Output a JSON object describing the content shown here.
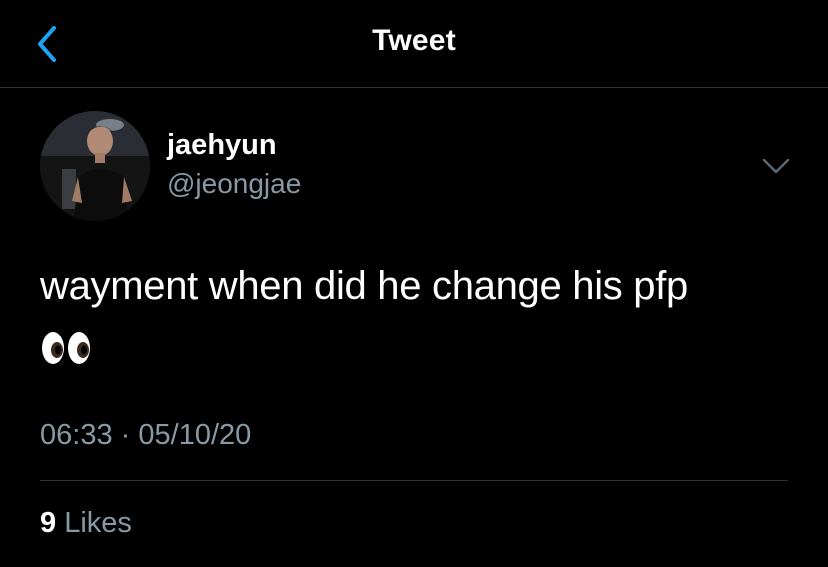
{
  "header": {
    "title": "Tweet",
    "back_icon": "chevron-left-icon"
  },
  "tweet": {
    "author": {
      "display_name": "jaehyun",
      "handle": "@jeongjae",
      "avatar": "profile-photo"
    },
    "more_icon": "chevron-down-icon",
    "text": "wayment when did he change his pfp",
    "emoji": "eyes-emoji",
    "time": "06:33",
    "separator": "·",
    "date": "05/10/20",
    "likes": {
      "count": "9",
      "label": "Likes"
    }
  },
  "colors": {
    "background": "#000000",
    "accent": "#1da1f2",
    "secondary_text": "#8899a6",
    "divider": "#2f3336"
  }
}
